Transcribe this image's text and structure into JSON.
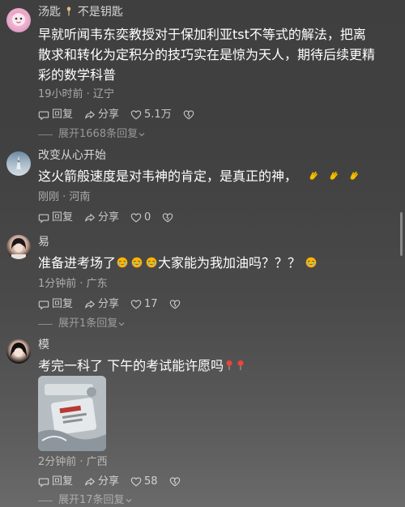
{
  "comments": [
    {
      "username": "汤匙",
      "username_suffix": "不是钥匙",
      "content_lines": [
        "早就听闻韦东奕教授对于保加利亚tst不等式的解法，把离",
        "散求和转化为定积分的技巧实在是惊为天人，期待后续更精",
        "彩的数学科普"
      ],
      "meta": "19小时前 · 辽宁",
      "reply_label": "回复",
      "share_label": "分享",
      "likes": "5.1万",
      "expand": "展开1668条回复"
    },
    {
      "username": "改变从心开始",
      "content": "这火箭般速度是对韦神的肯定，是真正的神，",
      "meta": "刚刚 · 河南",
      "reply_label": "回复",
      "share_label": "分享",
      "likes": "0"
    },
    {
      "username": "易",
      "content_before": "准备进考场了",
      "content_after": "大家能为我加油吗？？？",
      "meta": "1分钟前 · 广东",
      "reply_label": "回复",
      "share_label": "分享",
      "likes": "17",
      "expand": "展开1条回复"
    },
    {
      "username": "模",
      "content": "考完一科了  下午的考试能许愿吗",
      "meta": "2分钟前 · 广西",
      "reply_label": "回复",
      "share_label": "分享",
      "likes": "58",
      "expand": "展开17条回复"
    }
  ],
  "icons": {
    "reply": "comment-bubble-icon",
    "share": "share-arrow-icon",
    "like": "heart-icon",
    "dislike": "broken-heart-icon",
    "expand": "chevron-down-icon"
  },
  "colors": {
    "background": "#414141",
    "emoji_clap": "#f5c000",
    "emoji_cry": "#ffb400",
    "wish_icon": "#e8453c"
  }
}
